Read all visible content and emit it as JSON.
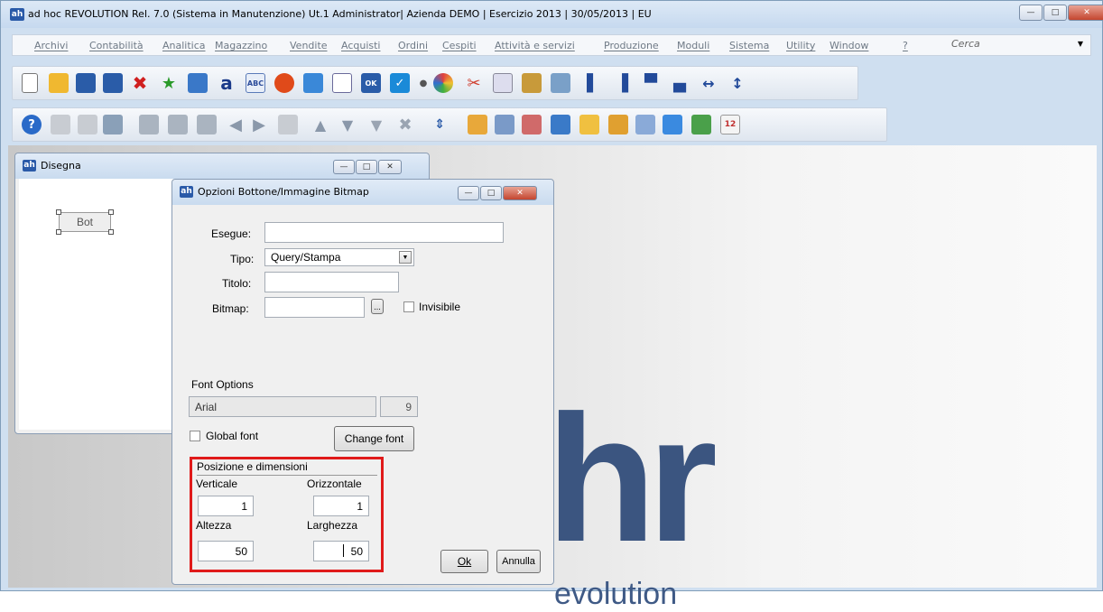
{
  "window": {
    "logo": "ah",
    "title": "ad hoc REVOLUTION Rel. 7.0 (Sistema in Manutenzione)  Ut.1 Administrator| Azienda DEMO | Esercizio 2013 | 30/05/2013 | EU"
  },
  "menu": {
    "items": [
      "Archivi",
      "Contabilità",
      "Analitica",
      "Magazzino",
      "Vendite",
      "Acquisti",
      "Ordini",
      "Cespiti",
      "Attività e servizi",
      "Produzione",
      "Moduli",
      "Sistema",
      "Utility",
      "Window",
      "?"
    ],
    "search_placeholder": "Cerca"
  },
  "background": {
    "brand_large": "hr",
    "brand_tagline": "evolution"
  },
  "disegna": {
    "title": "Disegna",
    "button_preview": "Bot"
  },
  "dialog": {
    "title": "Opzioni Bottone/Immagine Bitmap",
    "esegue_label": "Esegue:",
    "esegue_value": "",
    "tipo_label": "Tipo:",
    "tipo_value": "Query/Stampa",
    "titolo_label": "Titolo:",
    "titolo_value": "",
    "bitmap_label": "Bitmap:",
    "bitmap_value": "",
    "browse_label": "...",
    "invisibile_label": "Invisibile",
    "font_section": "Font Options",
    "font_name": "Arial",
    "font_size": "9",
    "global_font_label": "Global font",
    "change_font_label": "Change font",
    "pos_section": "Posizione e dimensioni",
    "verticale_label": "Verticale",
    "verticale_value": "1",
    "orizzontale_label": "Orizzontale",
    "orizzontale_value": "1",
    "altezza_label": "Altezza",
    "altezza_value": "50",
    "larghezza_label": "Larghezza",
    "larghezza_value": "50",
    "ok_label": "Ok",
    "annulla_label": "Annulla"
  },
  "colors": {
    "highlight_border": "#e01a1a",
    "brand_blue": "#3b5580"
  }
}
